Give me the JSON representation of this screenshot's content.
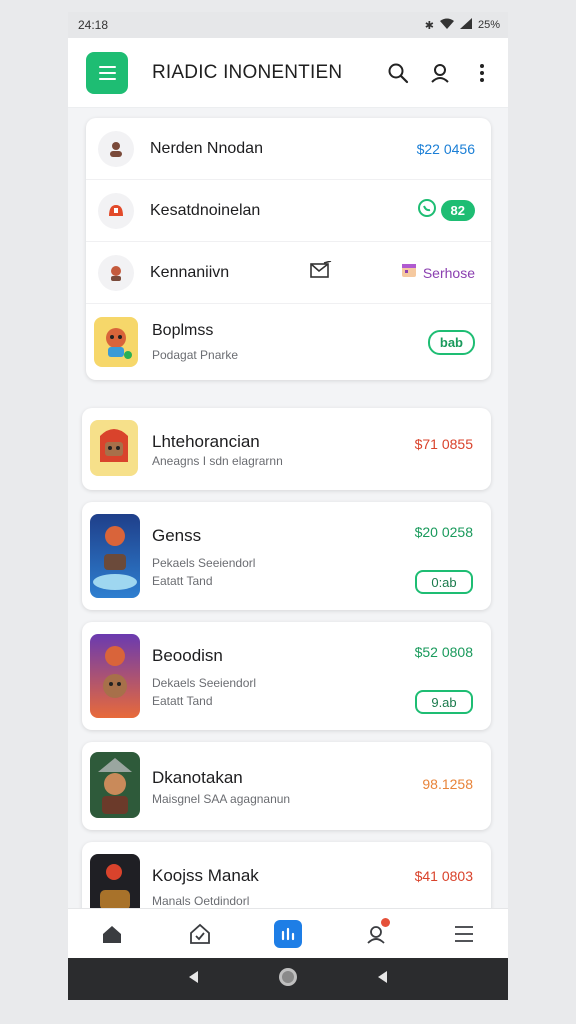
{
  "status": {
    "time": "24:18",
    "battery": "25%"
  },
  "app": {
    "title": "RIADIC INONENTIEN"
  },
  "group_rows": [
    {
      "name": "Nerden Nnodan",
      "value": "$22 0456"
    },
    {
      "name": "Kesatdnoinelan",
      "value": "82"
    },
    {
      "name": "Kennaniivn",
      "value": "Serhose"
    },
    {
      "name": "Boplmss",
      "subtitle": "Podagat Pnarke",
      "value": "bab"
    }
  ],
  "cards": [
    {
      "title": "Lhtehorancian",
      "subtitle": "Aneagns I sdn elagrarnn",
      "price": "$71 0855"
    },
    {
      "title": "Genss",
      "subtitle": "Pekaels Seeiendorl",
      "subtitle2": "Eatatt Tand",
      "price": "$20 0258",
      "button": "0:ab"
    },
    {
      "title": "Beoodisn",
      "subtitle": "Dekaels Seeiendorl",
      "subtitle2": "Eatatt Tand",
      "price": "$52 0808",
      "button": "9.ab"
    },
    {
      "title": "Dkanotakan",
      "subtitle": "Maisgnel SAA agagnanun",
      "price": "98.1258"
    },
    {
      "title": "Koojss Manak",
      "subtitle": "Manals Oetdindorl",
      "price": "$41 0803"
    }
  ],
  "colors": {
    "accent": "#1ebd73",
    "blue": "#1b7fd6",
    "purple": "#8b3fb0",
    "red": "#d9432c",
    "orange": "#e8843a"
  }
}
